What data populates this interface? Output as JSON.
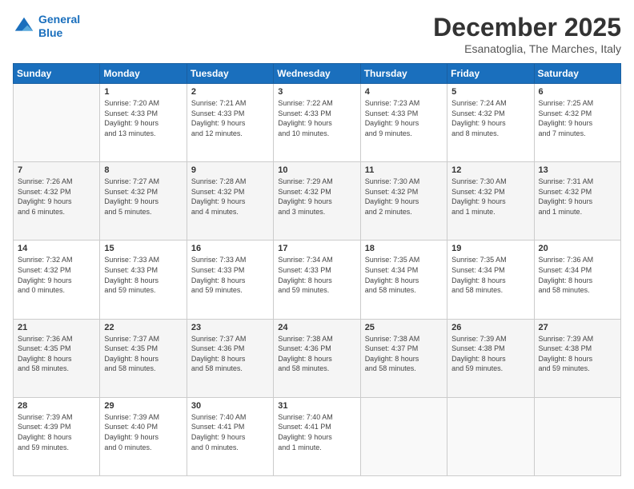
{
  "logo": {
    "line1": "General",
    "line2": "Blue"
  },
  "title": "December 2025",
  "subtitle": "Esanatoglia, The Marches, Italy",
  "days_header": [
    "Sunday",
    "Monday",
    "Tuesday",
    "Wednesday",
    "Thursday",
    "Friday",
    "Saturday"
  ],
  "weeks": [
    [
      {
        "num": "",
        "info": ""
      },
      {
        "num": "1",
        "info": "Sunrise: 7:20 AM\nSunset: 4:33 PM\nDaylight: 9 hours\nand 13 minutes."
      },
      {
        "num": "2",
        "info": "Sunrise: 7:21 AM\nSunset: 4:33 PM\nDaylight: 9 hours\nand 12 minutes."
      },
      {
        "num": "3",
        "info": "Sunrise: 7:22 AM\nSunset: 4:33 PM\nDaylight: 9 hours\nand 10 minutes."
      },
      {
        "num": "4",
        "info": "Sunrise: 7:23 AM\nSunset: 4:33 PM\nDaylight: 9 hours\nand 9 minutes."
      },
      {
        "num": "5",
        "info": "Sunrise: 7:24 AM\nSunset: 4:32 PM\nDaylight: 9 hours\nand 8 minutes."
      },
      {
        "num": "6",
        "info": "Sunrise: 7:25 AM\nSunset: 4:32 PM\nDaylight: 9 hours\nand 7 minutes."
      }
    ],
    [
      {
        "num": "7",
        "info": "Sunrise: 7:26 AM\nSunset: 4:32 PM\nDaylight: 9 hours\nand 6 minutes."
      },
      {
        "num": "8",
        "info": "Sunrise: 7:27 AM\nSunset: 4:32 PM\nDaylight: 9 hours\nand 5 minutes."
      },
      {
        "num": "9",
        "info": "Sunrise: 7:28 AM\nSunset: 4:32 PM\nDaylight: 9 hours\nand 4 minutes."
      },
      {
        "num": "10",
        "info": "Sunrise: 7:29 AM\nSunset: 4:32 PM\nDaylight: 9 hours\nand 3 minutes."
      },
      {
        "num": "11",
        "info": "Sunrise: 7:30 AM\nSunset: 4:32 PM\nDaylight: 9 hours\nand 2 minutes."
      },
      {
        "num": "12",
        "info": "Sunrise: 7:30 AM\nSunset: 4:32 PM\nDaylight: 9 hours\nand 1 minute."
      },
      {
        "num": "13",
        "info": "Sunrise: 7:31 AM\nSunset: 4:32 PM\nDaylight: 9 hours\nand 1 minute."
      }
    ],
    [
      {
        "num": "14",
        "info": "Sunrise: 7:32 AM\nSunset: 4:32 PM\nDaylight: 9 hours\nand 0 minutes."
      },
      {
        "num": "15",
        "info": "Sunrise: 7:33 AM\nSunset: 4:33 PM\nDaylight: 8 hours\nand 59 minutes."
      },
      {
        "num": "16",
        "info": "Sunrise: 7:33 AM\nSunset: 4:33 PM\nDaylight: 8 hours\nand 59 minutes."
      },
      {
        "num": "17",
        "info": "Sunrise: 7:34 AM\nSunset: 4:33 PM\nDaylight: 8 hours\nand 59 minutes."
      },
      {
        "num": "18",
        "info": "Sunrise: 7:35 AM\nSunset: 4:34 PM\nDaylight: 8 hours\nand 58 minutes."
      },
      {
        "num": "19",
        "info": "Sunrise: 7:35 AM\nSunset: 4:34 PM\nDaylight: 8 hours\nand 58 minutes."
      },
      {
        "num": "20",
        "info": "Sunrise: 7:36 AM\nSunset: 4:34 PM\nDaylight: 8 hours\nand 58 minutes."
      }
    ],
    [
      {
        "num": "21",
        "info": "Sunrise: 7:36 AM\nSunset: 4:35 PM\nDaylight: 8 hours\nand 58 minutes."
      },
      {
        "num": "22",
        "info": "Sunrise: 7:37 AM\nSunset: 4:35 PM\nDaylight: 8 hours\nand 58 minutes."
      },
      {
        "num": "23",
        "info": "Sunrise: 7:37 AM\nSunset: 4:36 PM\nDaylight: 8 hours\nand 58 minutes."
      },
      {
        "num": "24",
        "info": "Sunrise: 7:38 AM\nSunset: 4:36 PM\nDaylight: 8 hours\nand 58 minutes."
      },
      {
        "num": "25",
        "info": "Sunrise: 7:38 AM\nSunset: 4:37 PM\nDaylight: 8 hours\nand 58 minutes."
      },
      {
        "num": "26",
        "info": "Sunrise: 7:39 AM\nSunset: 4:38 PM\nDaylight: 8 hours\nand 59 minutes."
      },
      {
        "num": "27",
        "info": "Sunrise: 7:39 AM\nSunset: 4:38 PM\nDaylight: 8 hours\nand 59 minutes."
      }
    ],
    [
      {
        "num": "28",
        "info": "Sunrise: 7:39 AM\nSunset: 4:39 PM\nDaylight: 8 hours\nand 59 minutes."
      },
      {
        "num": "29",
        "info": "Sunrise: 7:39 AM\nSunset: 4:40 PM\nDaylight: 9 hours\nand 0 minutes."
      },
      {
        "num": "30",
        "info": "Sunrise: 7:40 AM\nSunset: 4:41 PM\nDaylight: 9 hours\nand 0 minutes."
      },
      {
        "num": "31",
        "info": "Sunrise: 7:40 AM\nSunset: 4:41 PM\nDaylight: 9 hours\nand 1 minute."
      },
      {
        "num": "",
        "info": ""
      },
      {
        "num": "",
        "info": ""
      },
      {
        "num": "",
        "info": ""
      }
    ]
  ]
}
